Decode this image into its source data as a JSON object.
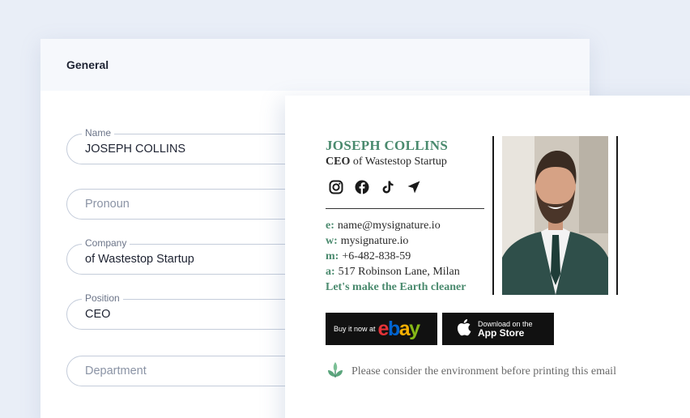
{
  "form": {
    "title": "General",
    "fields": [
      {
        "label": "Name",
        "value": "JOSEPH COLLINS"
      },
      {
        "label": "",
        "placeholder": "Pronoun"
      },
      {
        "label": "Company",
        "value": "of Wastestop Startup"
      },
      {
        "label": "Position",
        "value": "CEO"
      },
      {
        "label": "",
        "placeholder": "Department"
      }
    ]
  },
  "signature": {
    "name": "JOSEPH COLLINS",
    "position": "CEO",
    "company": "of Wastestop Startup",
    "socials": [
      "instagram-icon",
      "facebook-icon",
      "tiktok-icon",
      "location-arrow-icon"
    ],
    "contacts": [
      {
        "key": "e:",
        "value": "name@mysignature.io"
      },
      {
        "key": "w:",
        "value": "mysignature.io"
      },
      {
        "key": "m:",
        "value": "+6-482-838-59"
      },
      {
        "key": "a:",
        "value": "517 Robinson Lane, Milan"
      }
    ],
    "slogan": "Let's make the Earth cleaner",
    "ebay": {
      "prefix": "Buy it now at",
      "e": "e",
      "b": "b",
      "a": "a",
      "y": "y"
    },
    "appstore": {
      "line1": "Download on the",
      "line2": "App Store"
    },
    "eco_note": "Please consider the environment before printing this email"
  },
  "colors": {
    "accent": "#4a8a6e",
    "background": "#e9eef7"
  }
}
